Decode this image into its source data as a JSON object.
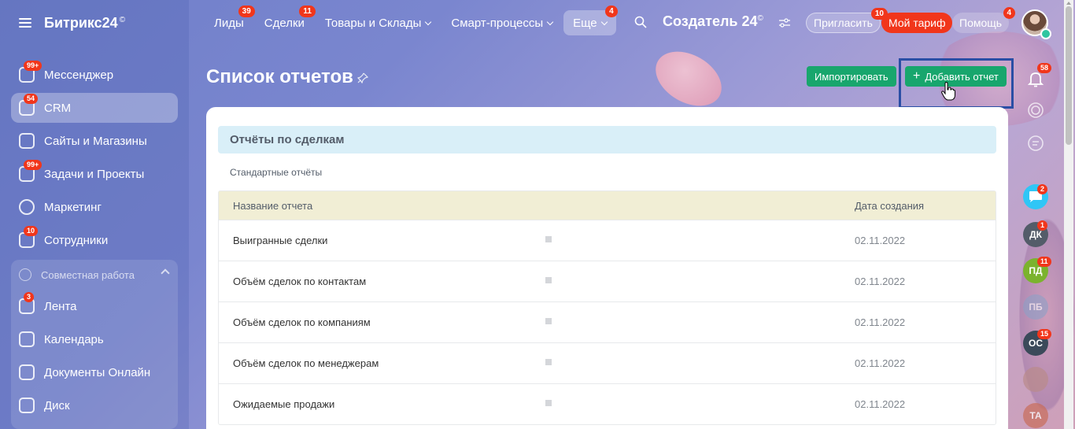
{
  "sidebar": {
    "logo": "Битрикс24",
    "logo_mark": "©",
    "items": [
      {
        "label": "Мессенджер",
        "badge": "99+"
      },
      {
        "label": "CRM",
        "badge": "54"
      },
      {
        "label": "Сайты и Магазины",
        "badge": ""
      },
      {
        "label": "Задачи и Проекты",
        "badge": "99+"
      },
      {
        "label": "Маркетинг",
        "badge": ""
      },
      {
        "label": "Сотрудники",
        "badge": "10"
      }
    ],
    "group_label": "Совместная работа",
    "group_items": [
      {
        "label": "Лента",
        "badge": "3"
      },
      {
        "label": "Календарь",
        "badge": ""
      },
      {
        "label": "Документы Онлайн",
        "badge": ""
      },
      {
        "label": "Диск",
        "badge": ""
      }
    ]
  },
  "topbar": {
    "nav": [
      {
        "label": "Лиды",
        "badge": "39"
      },
      {
        "label": "Сделки",
        "badge": "11"
      },
      {
        "label": "Товары и Склады",
        "badge": ""
      },
      {
        "label": "Смарт-процессы",
        "badge": ""
      },
      {
        "label": "Еще",
        "badge": "4"
      }
    ],
    "brand": "Создатель 24",
    "brand_mark": "©",
    "invite_label": "Пригласить",
    "invite_badge": "10",
    "tariff_label": "Мой тариф",
    "help_label": "Помощь",
    "help_badge": "4"
  },
  "page": {
    "title": "Список отчетов",
    "import_label": "Импортировать",
    "add_label": "Добавить отчет"
  },
  "reports": {
    "section_title": "Отчёты по сделкам",
    "subsection": "Стандартные отчёты",
    "columns": {
      "name": "Название отчета",
      "date": "Дата создания"
    },
    "rows": [
      {
        "name": "Выигранные сделки",
        "date": "02.11.2022"
      },
      {
        "name": "Объём сделок по контактам",
        "date": "02.11.2022"
      },
      {
        "name": "Объём сделок по компаниям",
        "date": "02.11.2022"
      },
      {
        "name": "Объём сделок по менеджерам",
        "date": "02.11.2022"
      },
      {
        "name": "Ожидаемые продажи",
        "date": "02.11.2022"
      }
    ]
  },
  "right_panel": {
    "notifications_badge": "58",
    "chat_badge": "2",
    "contacts": [
      {
        "initials": "ДК",
        "badge": "1",
        "color": "#535c69"
      },
      {
        "initials": "ПД",
        "badge": "11",
        "color": "#7bb32e"
      },
      {
        "initials": "ПБ",
        "badge": "",
        "color": "#8da0c7"
      },
      {
        "initials": "ОС",
        "badge": "15",
        "color": "#3b4a5a"
      },
      {
        "initials": "",
        "badge": "",
        "color": "#b98a8a"
      },
      {
        "initials": "ТА",
        "badge": "",
        "color": "#c96d5a"
      }
    ]
  },
  "colors": {
    "accent_green": "#18a66d",
    "badge_red": "#f1361b",
    "focus_frame": "#2a4ea5"
  }
}
